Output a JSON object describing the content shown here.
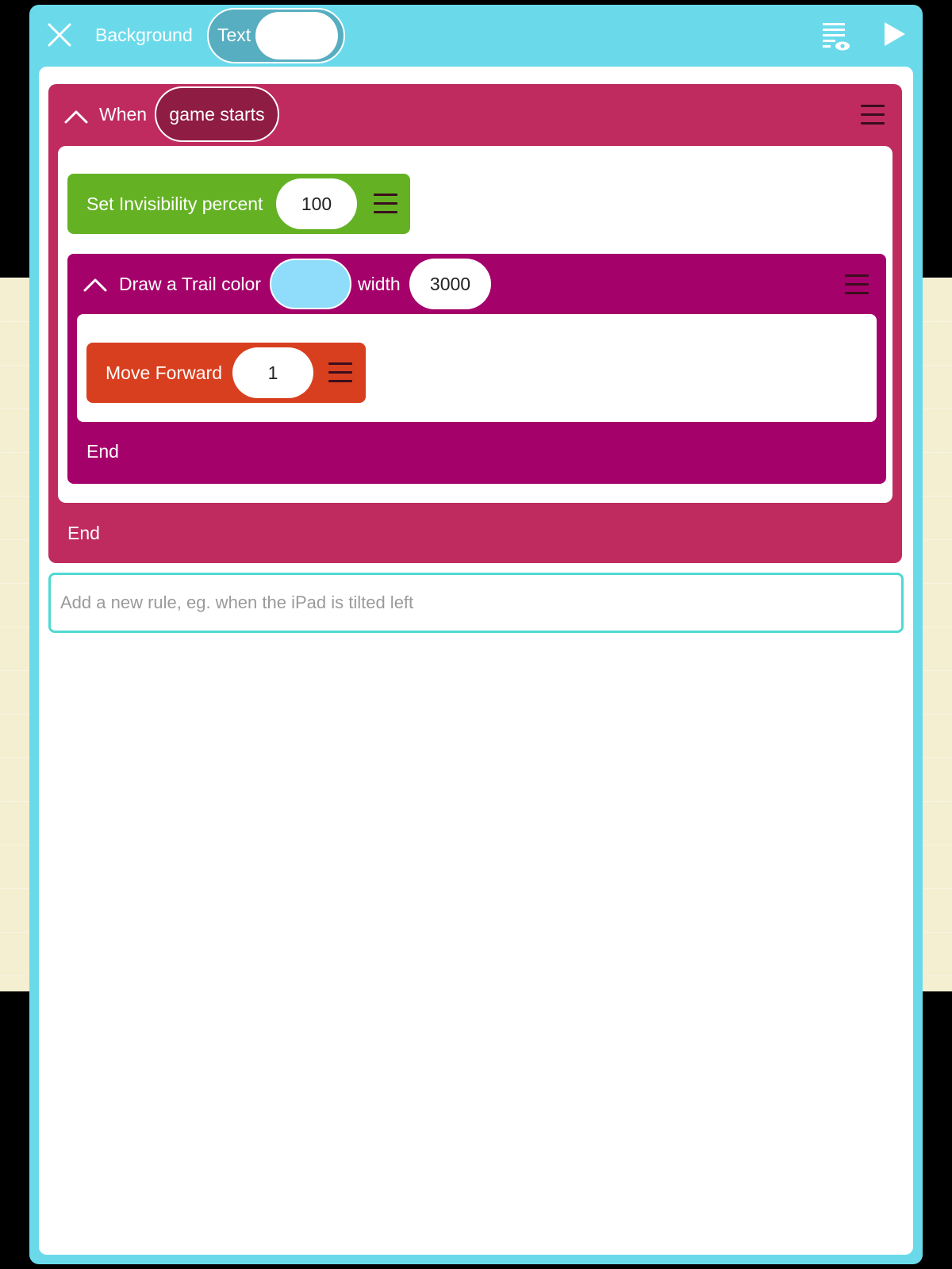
{
  "header": {
    "title": "Background",
    "toggle_label": "Text",
    "close_icon": "close-icon",
    "viewer_icon": "rule-viewer-icon",
    "play_icon": "play-icon"
  },
  "rule": {
    "when_label": "When",
    "event": "game starts",
    "end_label": "End",
    "color": "#bf2b5f"
  },
  "invisibility": {
    "label": "Set Invisibility percent",
    "value": "100",
    "color": "#64b224"
  },
  "trail": {
    "label": "Draw a Trail color",
    "color_value": "#8fddfb",
    "width_label": "width",
    "width_value": "3000",
    "end_label": "End",
    "color": "#a5016a"
  },
  "move": {
    "label": "Move Forward",
    "value": "1",
    "color": "#d83f1f"
  },
  "add_rule": {
    "placeholder": "Add a new rule, eg. when the iPad is tilted left"
  },
  "colors": {
    "frame": "#6adaeb",
    "paper": "#f5efd2",
    "add_rule_border": "#4fd9d1"
  }
}
